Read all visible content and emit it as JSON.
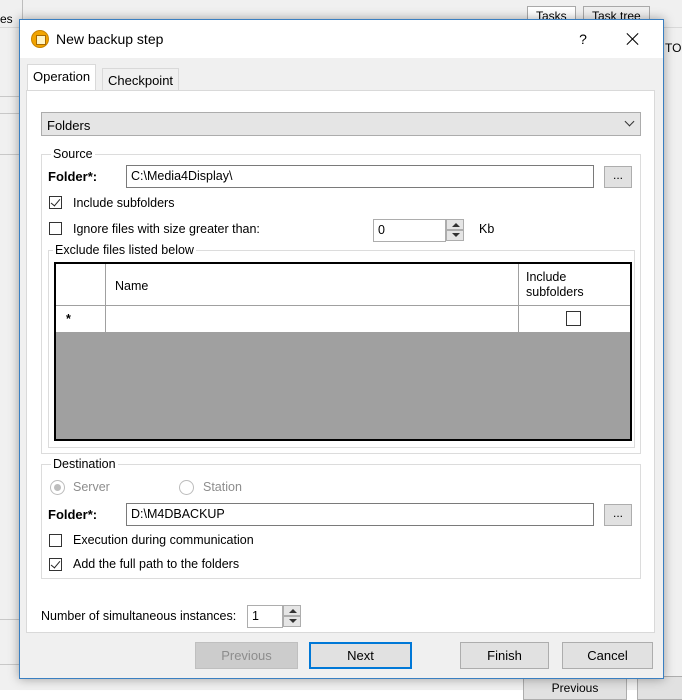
{
  "background": {
    "left_text": "es",
    "tabs": [
      "Tasks",
      "Task tree"
    ],
    "right_text": "TO",
    "previous_label": "Previous"
  },
  "dialog": {
    "title": "New backup step",
    "help_glyph": "?",
    "tabs": [
      {
        "label": "Operation"
      },
      {
        "label": "Checkpoint"
      }
    ],
    "operation": {
      "type_selected": "Folders",
      "source": {
        "legend": "Source",
        "folder_label": "Folder*:",
        "folder_value": "C:\\Media4Display\\",
        "browse_label": "...",
        "include_subfolders_label": "Include subfolders",
        "include_subfolders_checked": true,
        "ignore_size_label": "Ignore files with size greater than:",
        "ignore_size_checked": false,
        "size_value": "0",
        "size_unit": "Kb",
        "exclude": {
          "legend": "Exclude files listed below",
          "columns": [
            "Name",
            "Include subfolders"
          ],
          "new_row_marker": "*"
        }
      },
      "destination": {
        "legend": "Destination",
        "server_label": "Server",
        "station_label": "Station",
        "selected": "Server",
        "folder_label": "Folder*:",
        "folder_value": "D:\\M4DBACKUP",
        "browse_label": "...",
        "exec_during_comm_label": "Execution during communication",
        "exec_during_comm_checked": false,
        "full_path_label": "Add the full path to the folders",
        "full_path_checked": true
      },
      "instances_label": "Number of simultaneous instances:",
      "instances_value": "1"
    },
    "buttons": {
      "previous": "Previous",
      "next": "Next",
      "finish": "Finish",
      "cancel": "Cancel"
    }
  },
  "colors": {
    "dialog_border": "#3a7fc1",
    "default_button_border": "#0078d7",
    "grid_background": "#a0a0a0"
  }
}
